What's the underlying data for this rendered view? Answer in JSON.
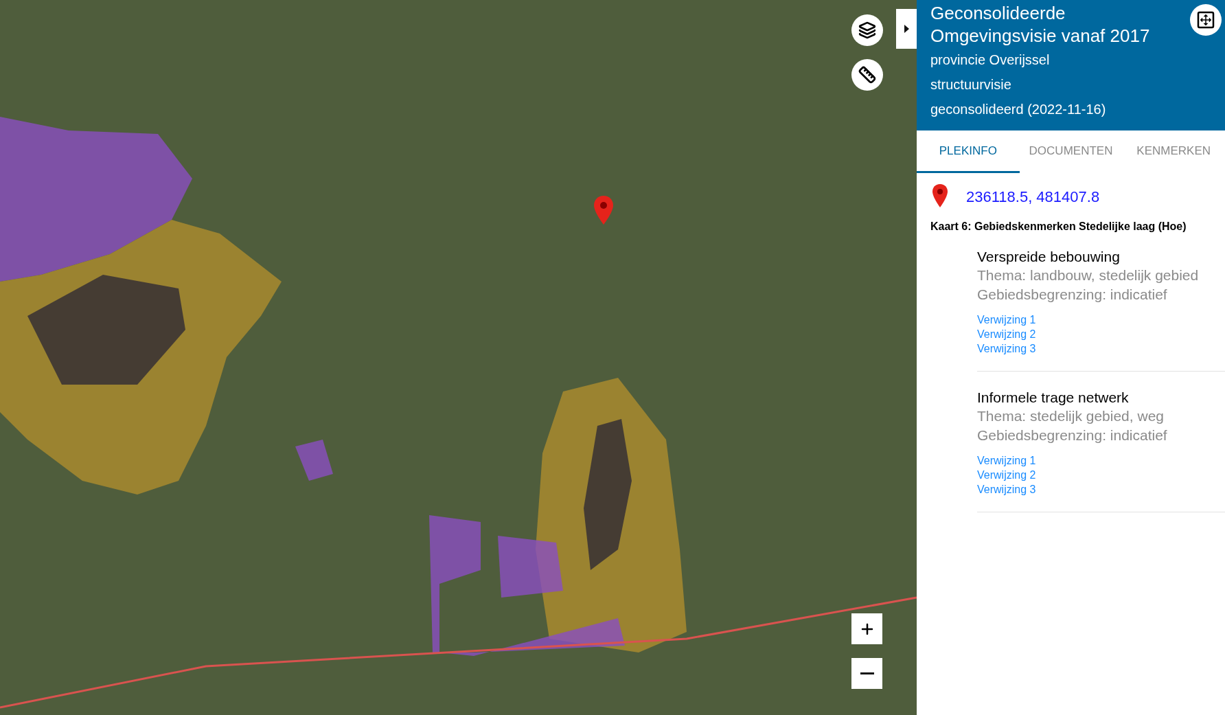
{
  "header": {
    "title": "Geconsolideerde Omgevingsvisie vanaf 2017",
    "lines": [
      "provincie Overijssel",
      "structuurvisie",
      "geconsolideerd (2022-11-16)"
    ]
  },
  "tabs": [
    {
      "label": "PLEKINFO",
      "selected": true
    },
    {
      "label": "DOCUMENTEN",
      "selected": false
    },
    {
      "label": "KENMERKEN",
      "selected": false
    }
  ],
  "location": {
    "coordinates": "236118.5, 481407.8"
  },
  "map_layer": "Kaart 6: Gebiedskenmerken Stedelijke laag (Hoe)",
  "features": [
    {
      "title": "Verspreide bebouwing",
      "details": [
        "Thema: landbouw, stedelijk gebied",
        "Gebiedsbegrenzing: indicatief"
      ],
      "links": [
        "Verwijzing 1",
        "Verwijzing 2",
        "Verwijzing 3"
      ]
    },
    {
      "title": "Informele trage netwerk",
      "details": [
        "Thema: stedelijk gebied, weg",
        "Gebiedsbegrenzing: indicatief"
      ],
      "links": [
        "Verwijzing 1",
        "Verwijzing 2",
        "Verwijzing 3"
      ]
    }
  ]
}
